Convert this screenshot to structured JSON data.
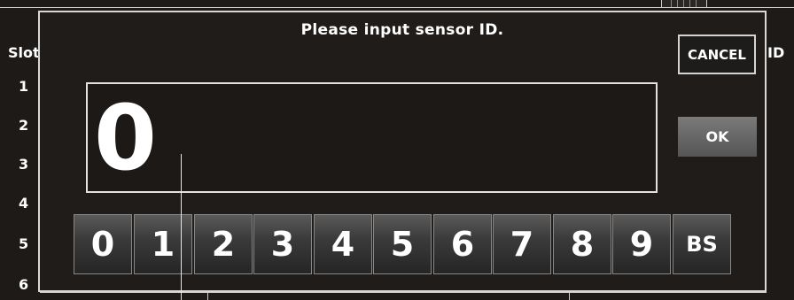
{
  "background": {
    "slot_header": "Slot",
    "id_header": "ID",
    "slot_numbers": [
      "1",
      "2",
      "3",
      "4",
      "5",
      "6"
    ]
  },
  "dialog": {
    "prompt": "Please input sensor ID.",
    "cancel_label": "CANCEL",
    "ok_label": "OK",
    "input_value": "0"
  },
  "keypad": {
    "keys": [
      "0",
      "1",
      "2",
      "3",
      "4",
      "5",
      "6",
      "7",
      "8",
      "9",
      "BS"
    ]
  }
}
